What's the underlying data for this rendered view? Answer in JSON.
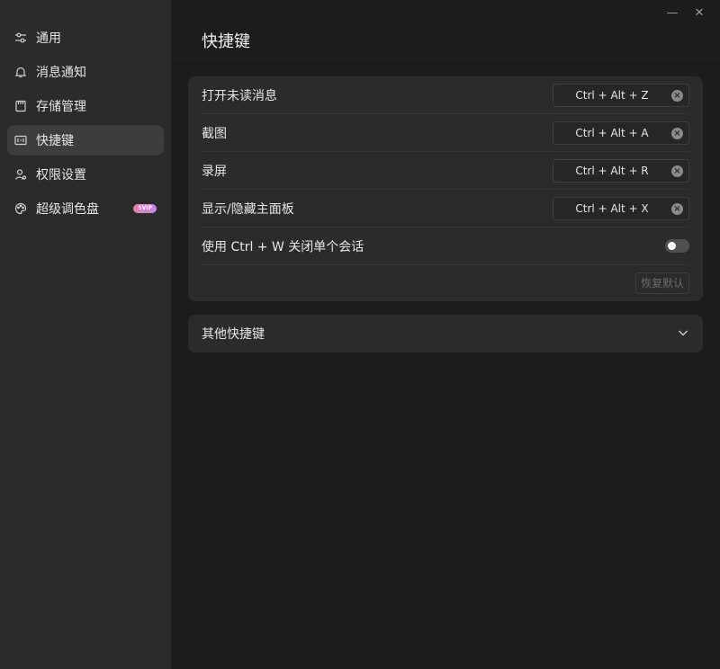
{
  "window": {
    "minimize_glyph": "—",
    "close_glyph": "✕"
  },
  "sidebar": {
    "items": [
      {
        "label": "通用",
        "icon": "sliders-icon"
      },
      {
        "label": "消息通知",
        "icon": "bell-icon"
      },
      {
        "label": "存储管理",
        "icon": "storage-icon"
      },
      {
        "label": "快捷键",
        "icon": "keyboard-icon",
        "active": true
      },
      {
        "label": "权限设置",
        "icon": "user-permission-icon"
      },
      {
        "label": "超级调色盘",
        "icon": "palette-icon",
        "badge": "SVIP"
      }
    ]
  },
  "main": {
    "title": "快捷键",
    "shortcuts": [
      {
        "label": "打开未读消息",
        "keys": "Ctrl + Alt + Z"
      },
      {
        "label": "截图",
        "keys": "Ctrl + Alt + A"
      },
      {
        "label": "录屏",
        "keys": "Ctrl + Alt + R"
      },
      {
        "label": "显示/隐藏主面板",
        "keys": "Ctrl + Alt + X"
      }
    ],
    "close_session": {
      "label": "使用 Ctrl + W 关闭单个会话",
      "enabled": false
    },
    "restore_label": "恢复默认",
    "other_label": "其他快捷键"
  },
  "colors": {
    "sidebar_bg": "#2b2b2b",
    "main_bg": "#1c1c1c",
    "card_bg": "#2b2b2b",
    "active_item": "#3d3d3d",
    "badge_gradient": "#f07aa8-#c487f2"
  }
}
